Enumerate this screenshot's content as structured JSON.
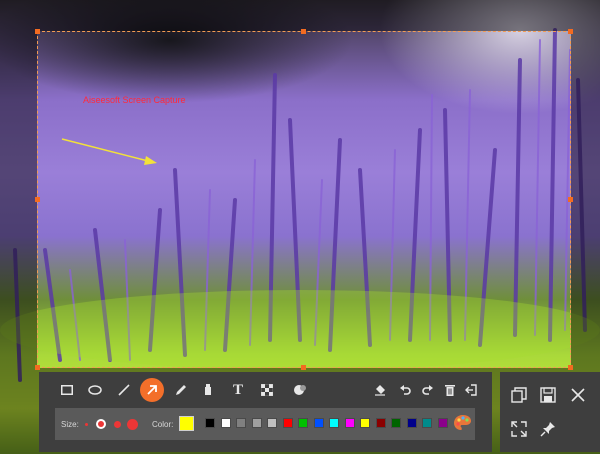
{
  "annotation": {
    "text": "Aiseesoft Screen Capture",
    "color": "#ff2a3a",
    "arrow_color": "#f2e13a"
  },
  "selection": {
    "border_color": "#f39b52",
    "handle_color": "#f36b21"
  },
  "toolbar": {
    "tools": [
      {
        "name": "rectangle-icon"
      },
      {
        "name": "ellipse-icon"
      },
      {
        "name": "line-icon"
      },
      {
        "name": "arrow-icon",
        "active": true
      },
      {
        "name": "pen-icon"
      },
      {
        "name": "highlighter-icon"
      },
      {
        "name": "text-icon",
        "glyph": "T"
      },
      {
        "name": "mosaic-icon"
      },
      {
        "name": "step-number-icon"
      },
      {
        "name": "eraser-icon"
      },
      {
        "name": "undo-icon"
      },
      {
        "name": "redo-icon"
      },
      {
        "name": "delete-icon"
      },
      {
        "name": "exit-icon"
      }
    ],
    "active_color": "#f36f2a",
    "size_label": "Size:",
    "color_label": "Color:",
    "sizes": [
      "small",
      "medium",
      "large"
    ],
    "current_color": "#ffff00",
    "palette": [
      "#000000",
      "#ffffff",
      "#808080",
      "#a0a0a0",
      "#c0c0c0",
      "#ff0000",
      "#00c000",
      "#0050ff",
      "#00ffff",
      "#ff00ff",
      "#ffff00",
      "#8b0000",
      "#006400",
      "#00008b",
      "#008b8b",
      "#8b008b"
    ]
  },
  "side_panel": {
    "buttons": [
      "copy-icon",
      "save-icon",
      "close-icon",
      "fullscreen-icon",
      "pin-icon"
    ]
  }
}
